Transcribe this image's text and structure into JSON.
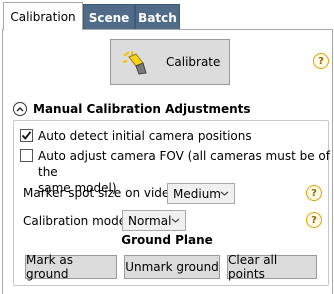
{
  "tabs": [
    {
      "label": "Calibration",
      "active": true
    },
    {
      "label": "Scene",
      "active": false
    },
    {
      "label": "Batch",
      "active": false
    }
  ],
  "calibrate_button": {
    "label": "Calibrate",
    "icon": "magic-wand-icon"
  },
  "help_icon_glyph": "?",
  "section": {
    "title": "Manual Calibration Adjustments",
    "collapsed": false
  },
  "checkboxes": [
    {
      "label": "Auto detect initial camera positions",
      "checked": true
    },
    {
      "label_line1": "Auto adjust camera FOV (all cameras must be of the",
      "label_line2": "same model)",
      "checked": false
    }
  ],
  "marker_spot": {
    "label": "Marker spot size on video:",
    "value": "Medium"
  },
  "calibration_mode": {
    "label": "Calibration mode:",
    "value": "Normal"
  },
  "ground_plane": {
    "title": "Ground Plane",
    "buttons": [
      "Mark as ground",
      "Unmark ground",
      "Clear all points"
    ]
  },
  "colors": {
    "inactive_tab": "#4f6b87",
    "help_border": "#e0a100",
    "button_bg": "#dcdcdc"
  }
}
